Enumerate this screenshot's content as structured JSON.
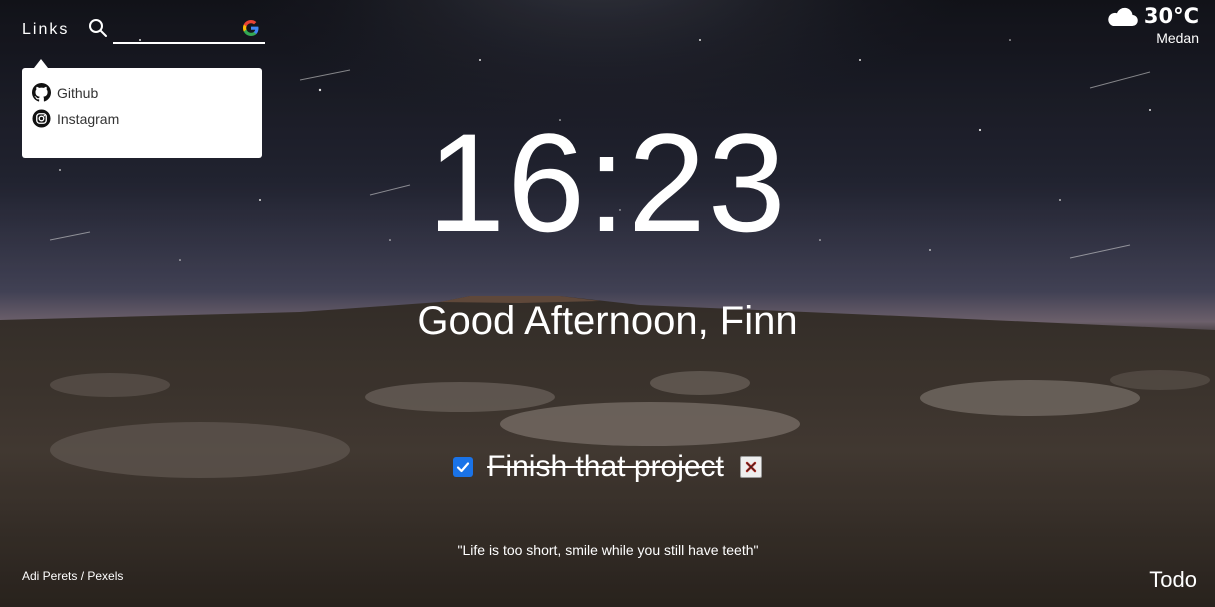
{
  "header": {
    "links_label": "Links",
    "search": {
      "value": "",
      "placeholder": ""
    }
  },
  "links_panel": {
    "items": [
      {
        "label": "Github",
        "icon": "github-icon"
      },
      {
        "label": "Instagram",
        "icon": "instagram-icon"
      }
    ]
  },
  "weather": {
    "icon": "cloud-icon",
    "temperature": "30°C",
    "city": "Medan"
  },
  "clock": {
    "time": "16:23"
  },
  "greeting": "Good Afternoon, Finn",
  "todo": {
    "text": "Finish that project",
    "done": true
  },
  "quote": "\"Life is too short, smile while you still have teeth\"",
  "photo_credit": "Adi Perets / Pexels",
  "todo_button_label": "Todo",
  "colors": {
    "checkbox_accent": "#1a73e8",
    "panel_background": "#ffffff"
  }
}
